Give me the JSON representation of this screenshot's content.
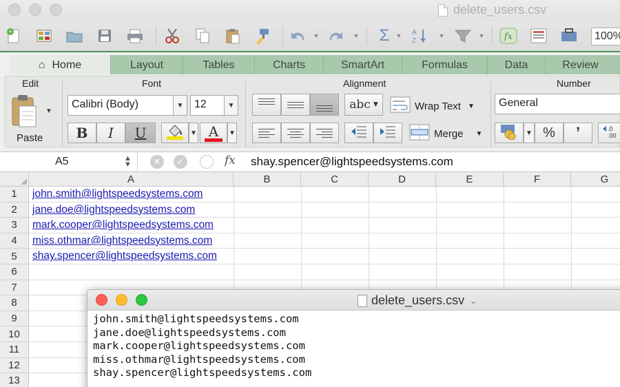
{
  "window": {
    "title": "delete_users.csv"
  },
  "quick_toolbar": {
    "icons": [
      "new-icon",
      "templates-icon",
      "open-icon",
      "save-icon",
      "print-icon",
      "cut-icon",
      "copy-icon",
      "paste-icon",
      "format-painter-icon",
      "undo-icon",
      "redo-icon",
      "autosum-icon",
      "sort-icon",
      "filter-icon",
      "function-icon",
      "gallery-icon",
      "toolbox-icon"
    ],
    "zoom": "100%"
  },
  "tabs": [
    "Home",
    "Layout",
    "Tables",
    "Charts",
    "SmartArt",
    "Formulas",
    "Data",
    "Review"
  ],
  "ribbon": {
    "edit_label": "Edit",
    "paste_label": "Paste",
    "font_label": "Font",
    "font_name": "Calibri (Body)",
    "font_size": "12",
    "bold": "B",
    "italic": "I",
    "underline": "U",
    "font_color_glyph": "A",
    "alignment_label": "Alignment",
    "wrap_text": "Wrap Text",
    "merge": "Merge",
    "abc": "abc",
    "number_label": "Number",
    "number_format": "General",
    "percent": "%",
    "comma": "’",
    "colors": {
      "fill": "#f5e400",
      "font": "#e3141b"
    }
  },
  "formula_bar": {
    "cell_ref": "A5",
    "fx": "fx",
    "content": "shay.spencer@lightspeedsystems.com"
  },
  "sheet": {
    "columns": [
      "A",
      "B",
      "C",
      "D",
      "E",
      "F",
      "G"
    ],
    "rows": [
      "1",
      "2",
      "3",
      "4",
      "5",
      "6",
      "7",
      "8",
      "9",
      "10",
      "11",
      "12",
      "13"
    ],
    "cells_a": [
      "john.smith@lightspeedsystems.com",
      "jane.doe@lightspeedsystems.com",
      "mark.cooper@lightspeedsystems.com",
      "miss.othmar@lightspeedsystems.com",
      "shay.spencer@lightspeedsystems.com"
    ]
  },
  "textedit": {
    "title": "delete_users.csv",
    "lines": [
      "john.smith@lightspeedsystems.com",
      "jane.doe@lightspeedsystems.com",
      "mark.cooper@lightspeedsystems.com",
      "miss.othmar@lightspeedsystems.com",
      "shay.spencer@lightspeedsystems.com"
    ]
  }
}
